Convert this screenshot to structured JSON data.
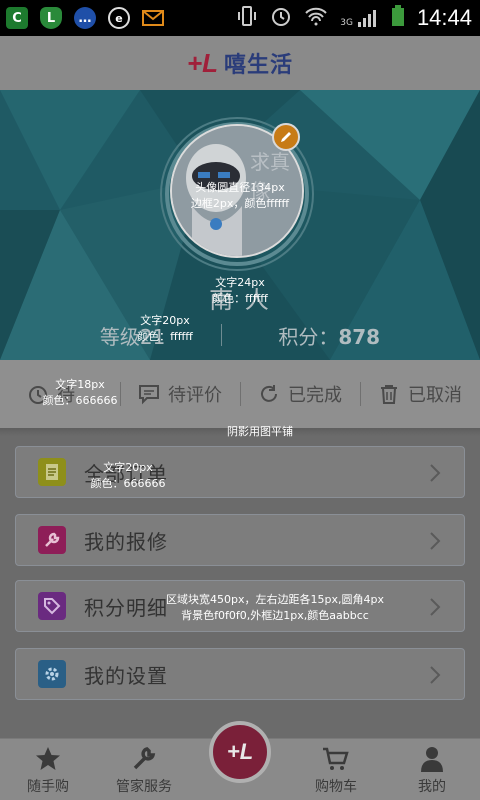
{
  "status_bar": {
    "time": "14:44",
    "network": "3G",
    "left_icons": [
      "notification-app-icon",
      "security-shield-icon",
      "chat-icon",
      "browser-icon",
      "mail-icon"
    ],
    "right_icons": [
      "vibrate-icon",
      "alarm-icon",
      "wifi-icon",
      "signal-icon",
      "battery-icon"
    ]
  },
  "header": {
    "logo_mark": "+L",
    "logo_text": "嘻生活"
  },
  "profile": {
    "username": "南    人",
    "badge_partial": "求真像",
    "stat_left": "等级21",
    "stat_right_label": "积分：",
    "stat_right_value": "878"
  },
  "annotations": {
    "avatar": [
      "头像圆直径134px",
      "边框2px，颜色ffffff"
    ],
    "username": [
      "文字24px",
      "颜色：ffffff"
    ],
    "stats": [
      "文字20px",
      "颜色：ffffff"
    ],
    "tabs": [
      "文字18px",
      "颜色：666666"
    ],
    "shadow": [
      "阴影用图平铺"
    ],
    "menu_text": [
      "文字20px",
      "颜色：666666"
    ],
    "menu_box": [
      "区域块宽450px，左右边距各15px,圆角4px",
      "背景色f0f0f0,外框边1px,颜色aabbcc"
    ]
  },
  "order_tabs": [
    {
      "label": "待…",
      "icon": "alarm-clock-icon"
    },
    {
      "label": "待评价",
      "icon": "comment-icon"
    },
    {
      "label": "已完成",
      "icon": "refresh-icon"
    },
    {
      "label": "已取消",
      "icon": "trash-icon"
    }
  ],
  "menu": [
    {
      "label": "全部订单",
      "icon": "document-icon",
      "icon_color": "#8e8f1a"
    },
    {
      "label": "我的报修",
      "icon": "wrench-icon",
      "icon_color": "#8e1e58"
    },
    {
      "label": "积分明细",
      "icon": "tag-icon",
      "icon_color": "#6a2a80"
    },
    {
      "label": "我的设置",
      "icon": "gear-icon",
      "icon_color": "#2a5f86"
    }
  ],
  "bottom_nav": [
    {
      "label": "随手购",
      "icon": "star-icon"
    },
    {
      "label": "管家服务",
      "icon": "tools-icon"
    },
    {
      "label": "+L",
      "icon": "home-logo-icon"
    },
    {
      "label": "购物车",
      "icon": "cart-icon"
    },
    {
      "label": "我的",
      "icon": "person-icon"
    }
  ],
  "colors": {
    "brand_red": "#a0203a",
    "brand_blue": "#2a3c7a",
    "overlay_bg": "#6b6b6b",
    "banner": "#1f5a64"
  }
}
